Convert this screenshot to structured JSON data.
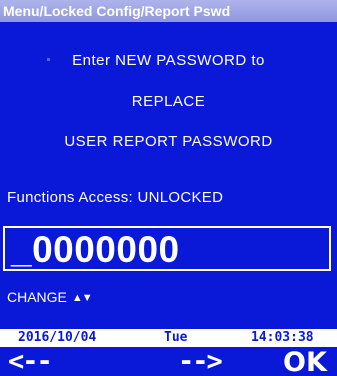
{
  "window": {
    "title": "Menu/Locked Config/Report Pswd"
  },
  "prompt": {
    "line1": "Enter NEW PASSWORD to",
    "line2": "REPLACE",
    "line3": "USER REPORT PASSWORD"
  },
  "access": {
    "text": "Functions Access: UNLOCKED"
  },
  "password_field": {
    "value": "_0000000"
  },
  "change": {
    "label": "CHANGE",
    "arrows": "▲▼"
  },
  "status": {
    "date": "2016/10/04",
    "day": "Tue",
    "time": "14:03:38"
  },
  "softkeys": {
    "left": "<--",
    "right": "-->",
    "ok": "OK"
  },
  "colors": {
    "background": "#0a18d8",
    "title_bar": "#9aa1e4",
    "text": "#ffffff",
    "status_bar": "#ffffff"
  }
}
